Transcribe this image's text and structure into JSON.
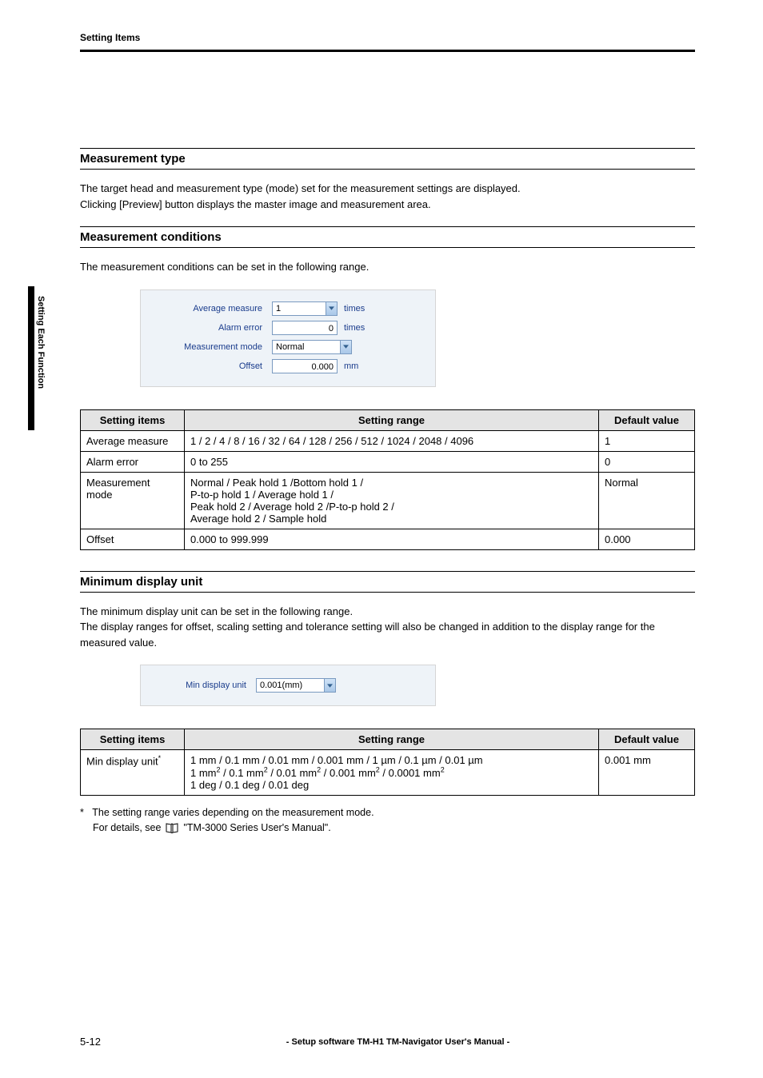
{
  "header": {
    "section_label": "Setting Items"
  },
  "side_tab": "Setting Each Function",
  "section1": {
    "heading": "Measurement type",
    "p1": "The target head and measurement type (mode) set for the measurement settings are displayed.",
    "p2": "Clicking [Preview] button displays the master image and measurement area."
  },
  "section2": {
    "heading": "Measurement conditions",
    "p1": "The measurement conditions can be set in the following range.",
    "panel": {
      "rows": [
        {
          "label": "Average measure",
          "value": "1",
          "type": "select",
          "unit": "times"
        },
        {
          "label": "Alarm error",
          "value": "0",
          "type": "input",
          "unit": "times"
        },
        {
          "label": "Measurement mode",
          "value": "Normal",
          "type": "select",
          "unit": ""
        },
        {
          "label": "Offset",
          "value": "0.000",
          "type": "input",
          "unit": "mm"
        }
      ]
    },
    "table": {
      "headers": [
        "Setting items",
        "Setting range",
        "Default value"
      ],
      "rows": [
        {
          "item": "Average measure",
          "range": "1 / 2 / 4 / 8 / 16 / 32 / 64 / 128 / 256 / 512 / 1024 / 2048 / 4096",
          "def": "1"
        },
        {
          "item": "Alarm error",
          "range": "0 to 255",
          "def": "0"
        },
        {
          "item": "Measurement mode",
          "range": "Normal / Peak hold 1 /Bottom hold 1 /\nP-to-p hold 1 / Average hold 1 /\nPeak hold 2 / Average hold 2 /P-to-p hold 2 /\nAverage hold 2 / Sample hold",
          "def": "Normal"
        },
        {
          "item": "Offset",
          "range": "0.000 to 999.999",
          "def": "0.000"
        }
      ]
    }
  },
  "section3": {
    "heading": "Minimum display unit",
    "p1": "The minimum display unit can be set in the following range.",
    "p2": "The display ranges for offset, scaling setting and tolerance setting will also be changed in addition to the display range for the measured value.",
    "panel": {
      "label": "Min display unit",
      "value": "0.001(mm)"
    },
    "table": {
      "headers": [
        "Setting items",
        "Setting range",
        "Default value"
      ],
      "rows": [
        {
          "item": "Min display unit",
          "item_marker": "*",
          "range_l1": "1 mm / 0.1 mm / 0.01 mm / 0.001 mm / 1 µm / 0.1 µm / 0.01 µm",
          "range_l2_a": "1 mm",
          "range_l2_b": " / 0.1 mm",
          "range_l2_c": " / 0.01 mm",
          "range_l2_d": " / 0.001 mm",
          "range_l2_e": " / 0.0001 mm",
          "range_l3": "1 deg / 0.1 deg / 0.01 deg",
          "def": "0.001 mm"
        }
      ]
    },
    "footnote": {
      "star": "*",
      "l1": "The setting range varies depending on the measurement mode.",
      "l2a": "For details, see",
      "l2b": "\"TM-3000 Series User's Manual\"."
    }
  },
  "footer": {
    "page_num": "5-12",
    "manual_title": "- Setup software TM-H1 TM-Navigator User's Manual -"
  },
  "sup2": "2"
}
